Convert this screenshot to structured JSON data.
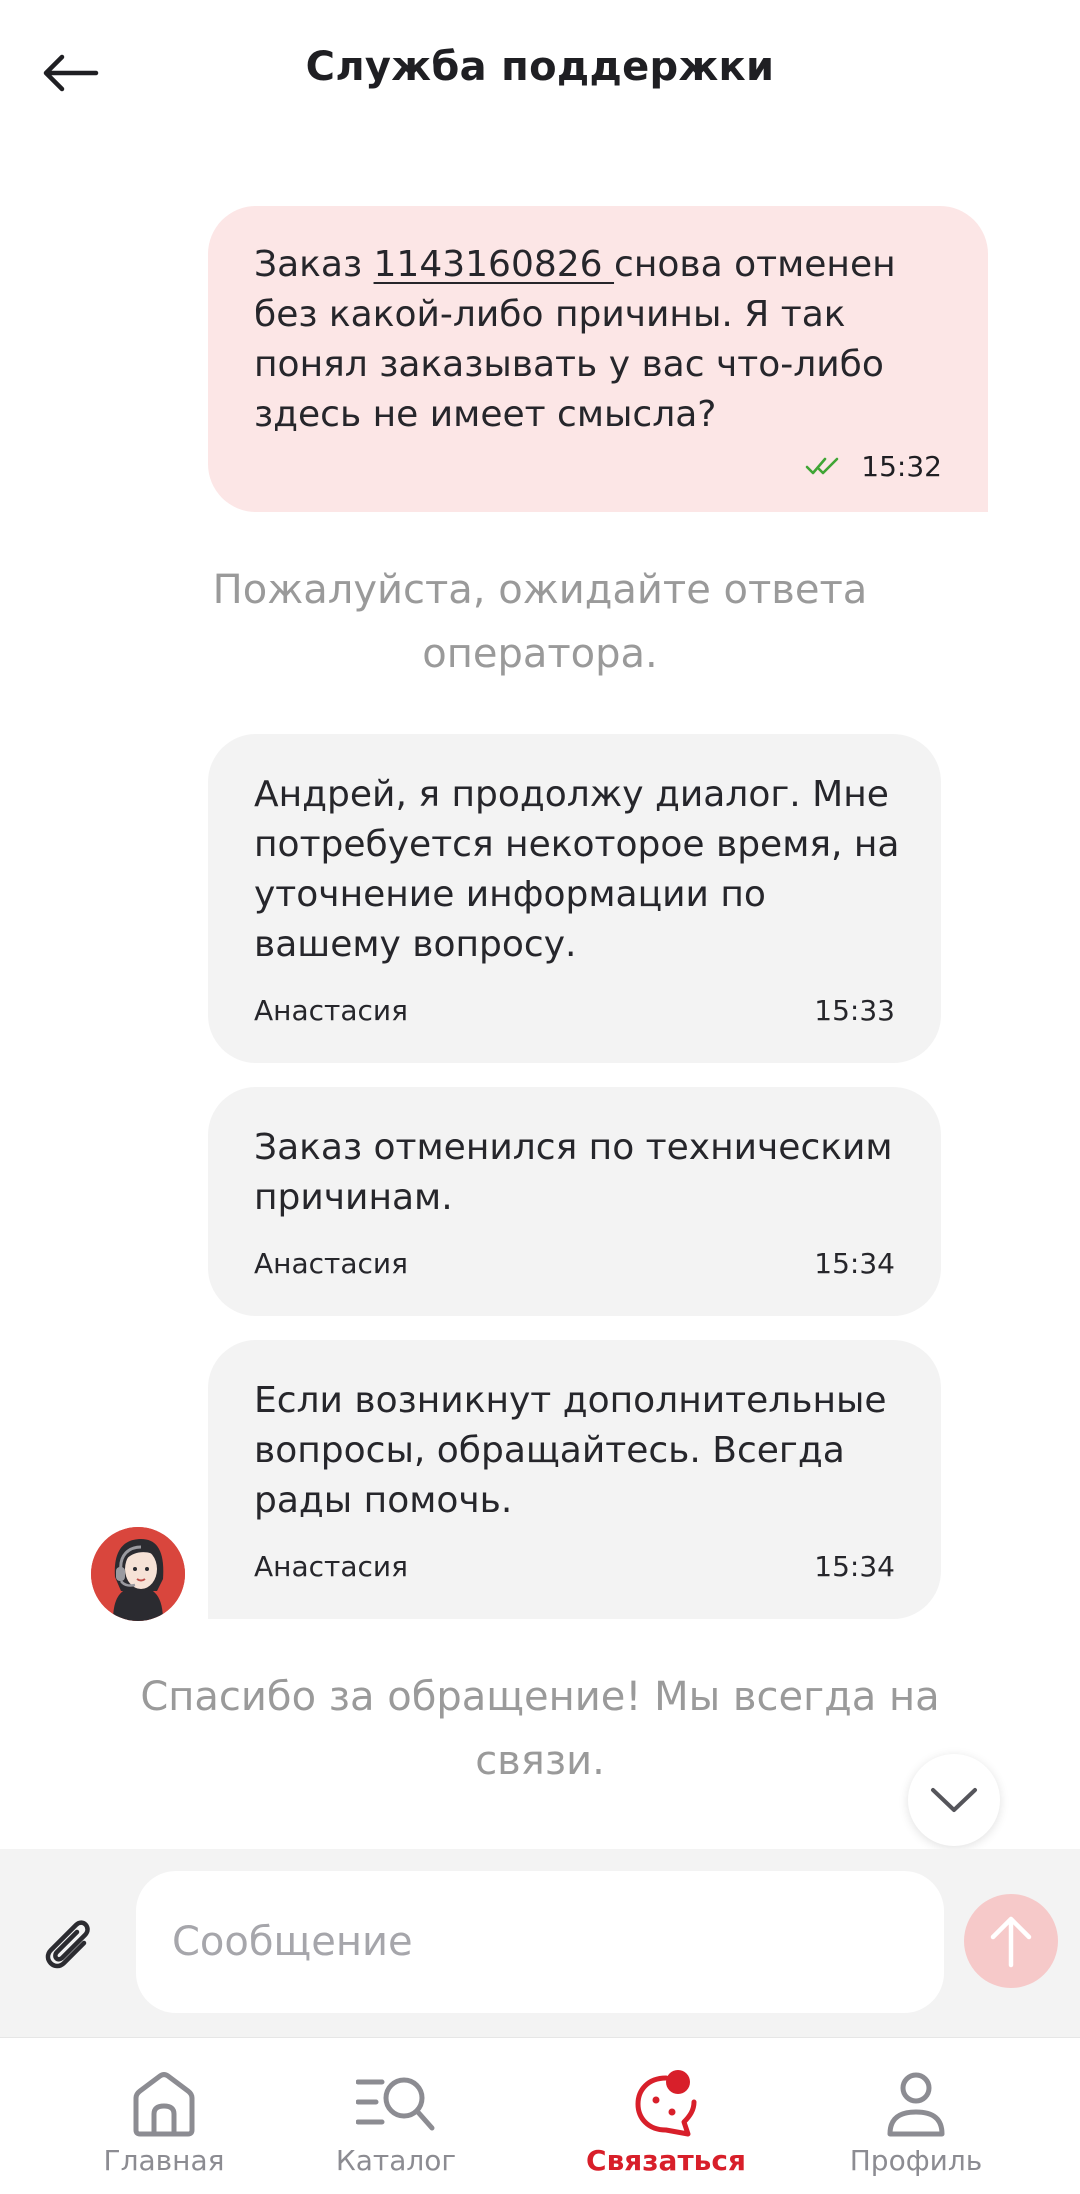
{
  "header": {
    "title": "Служба поддержки"
  },
  "messages": {
    "user": {
      "prefix": "Заказ ",
      "order_number": "1143160826 ",
      "rest": "снова отменен без какой-либо причины. Я так понял заказывать у вас что-либо здесь не имеет смысла?",
      "time": "15:32",
      "status_color": "#3fa535"
    },
    "wait_note": "Пожалуйста, ожидайте ответа оператора.",
    "operator": [
      {
        "text": "Андрей, я продолжу диалог. Мне потребуется некоторое время, на уточнение информации по вашему вопросу.",
        "author": "Анастасия",
        "time": "15:33"
      },
      {
        "text": "Заказ отменился по техническим причинам.",
        "author": "Анастасия",
        "time": "15:34"
      },
      {
        "text": "Если возникнут дополнительные вопросы, обращайтесь. Всегда рады помочь.",
        "author": "Анастасия",
        "time": "15:34"
      }
    ],
    "thanks_note": "Спасибо за обращение! Мы всегда на связи."
  },
  "composer": {
    "placeholder": "Сообщение"
  },
  "nav": {
    "items": [
      {
        "label": "Главная",
        "icon": "home-icon"
      },
      {
        "label": "Каталог",
        "icon": "catalog-search-icon"
      },
      {
        "label": "Связаться",
        "icon": "chat-support-icon",
        "active": true
      },
      {
        "label": "Профиль",
        "icon": "profile-icon"
      }
    ]
  },
  "colors": {
    "accent": "#d81f2a",
    "user_bubble": "#fce6e6",
    "operator_bubble": "#f3f3f3",
    "send_button": "#f6c9c9"
  }
}
